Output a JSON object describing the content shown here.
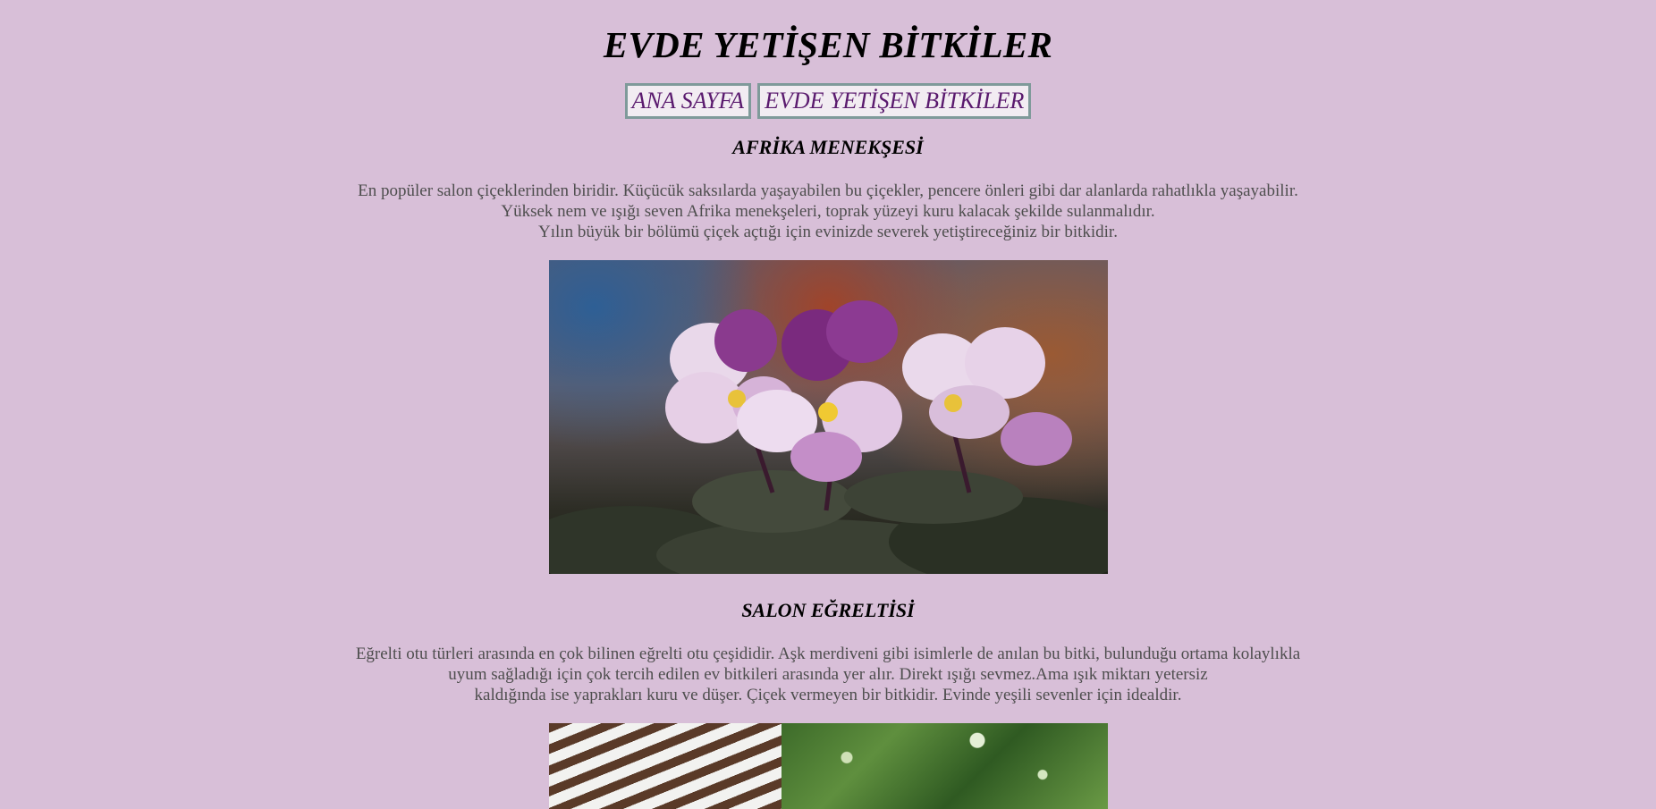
{
  "page": {
    "title": "EVDE YETİŞEN BİTKİLER",
    "background_color": "#d8bfd8"
  },
  "nav": {
    "items": [
      {
        "label": "ANA SAYFA"
      },
      {
        "label": "EVDE YETİŞEN BİTKİLER"
      }
    ]
  },
  "sections": [
    {
      "title": "AFRİKA MENEKŞESİ",
      "lines": [
        "En popüler salon çiçeklerinden biridir. Küçücük saksılarda yaşayabilen bu çiçekler, pencere önleri gibi dar alanlarda rahatlıkla yaşayabilir.",
        "Yüksek nem ve ışığı seven Afrika menekşeleri, toprak yüzeyi kuru kalacak şekilde sulanmalıdır.",
        "Yılın büyük bir bölümü çiçek açtığı için evinizde severek yetiştireceğiniz bir bitkidir."
      ],
      "image": "african-violet-photo"
    },
    {
      "title": "SALON EĞRELTİSİ",
      "lines": [
        "Eğrelti otu türleri arasında en çok bilinen eğrelti otu çeşididir. Aşk merdiveni gibi isimlerle de anılan bu bitki, bulunduğu ortama kolaylıkla",
        "uyum sağladığı için çok tercih edilen ev bitkileri arasında yer alır. Direkt ışığı sevmez.Ama ışık miktarı yetersiz",
        "kaldığında ise yaprakları kuru ve düşer. Çiçek vermeyen bir bitkidir. Evinde yeşili sevenler için idealdir."
      ],
      "image": "hanging-fern-photo"
    }
  ]
}
